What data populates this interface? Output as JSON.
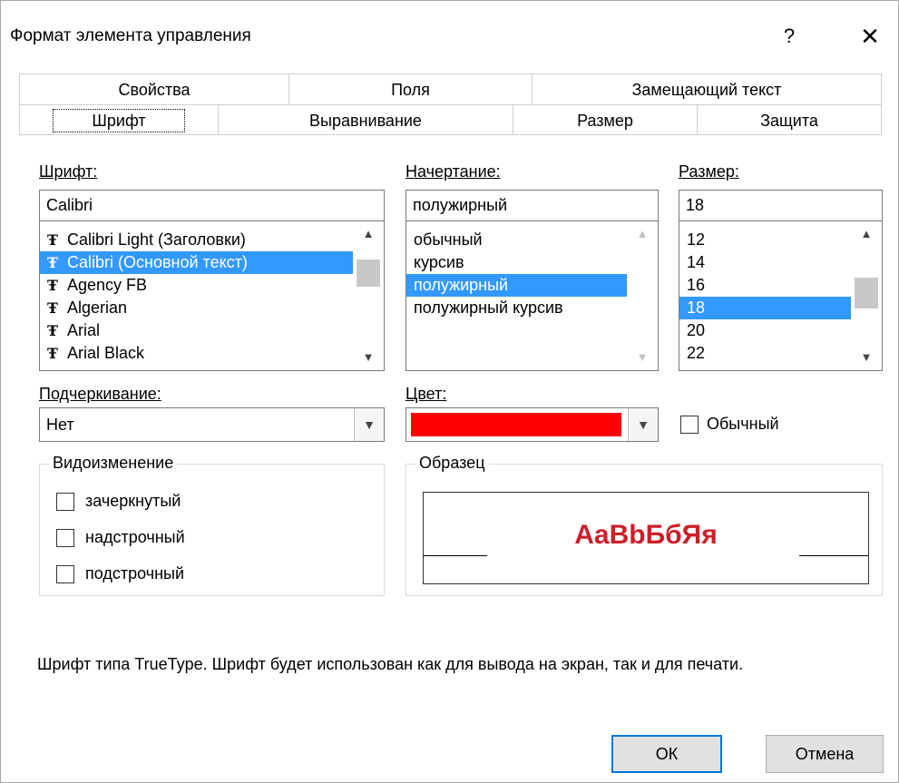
{
  "window": {
    "title": "Формат элемента управления",
    "help": "?",
    "close": "✕"
  },
  "tabs_row1": [
    "Свойства",
    "Поля",
    "Замещающий текст"
  ],
  "tabs_row2": [
    "Шрифт",
    "Выравнивание",
    "Размер",
    "Защита"
  ],
  "active_tab": "Шрифт",
  "font": {
    "label": "Шрифт:",
    "value": "Calibri",
    "items": [
      {
        "name": "Calibri Light (Заголовки)",
        "selected": false
      },
      {
        "name": "Calibri (Основной текст)",
        "selected": true
      },
      {
        "name": "Agency FB",
        "selected": false
      },
      {
        "name": "Algerian",
        "selected": false
      },
      {
        "name": "Arial",
        "selected": false
      },
      {
        "name": "Arial Black",
        "selected": false
      }
    ],
    "item_icon": "truetype-font-icon"
  },
  "style": {
    "label": "Начертание:",
    "value": "полужирный",
    "items": [
      {
        "name": "обычный",
        "selected": false
      },
      {
        "name": "курсив",
        "selected": false
      },
      {
        "name": "полужирный",
        "selected": true
      },
      {
        "name": "полужирный курсив",
        "selected": false
      }
    ]
  },
  "size": {
    "label": "Размер:",
    "value": "18",
    "items": [
      {
        "name": "12",
        "selected": false
      },
      {
        "name": "14",
        "selected": false
      },
      {
        "name": "16",
        "selected": false
      },
      {
        "name": "18",
        "selected": true
      },
      {
        "name": "20",
        "selected": false
      },
      {
        "name": "22",
        "selected": false
      }
    ]
  },
  "underline": {
    "label": "Подчеркивание:",
    "value": "Нет"
  },
  "color": {
    "label": "Цвет:",
    "value": "#ff0000",
    "normal_label": "Обычный",
    "normal_checked": false
  },
  "effects": {
    "title": "Видоизменение",
    "items": [
      {
        "label": "зачеркнутый",
        "checked": false
      },
      {
        "label": "надстрочный",
        "checked": false
      },
      {
        "label": "подстрочный",
        "checked": false
      }
    ]
  },
  "sample": {
    "title": "Образец",
    "text": "AaBbБбЯя",
    "color": "#cc1f2a"
  },
  "description": "Шрифт типа TrueType. Шрифт будет использован как для вывода на экран, так и для печати.",
  "buttons": {
    "ok": "ОК",
    "cancel": "Отмена"
  },
  "colors": {
    "selection": "#3399ff",
    "default_button_border": "#0078d7"
  }
}
